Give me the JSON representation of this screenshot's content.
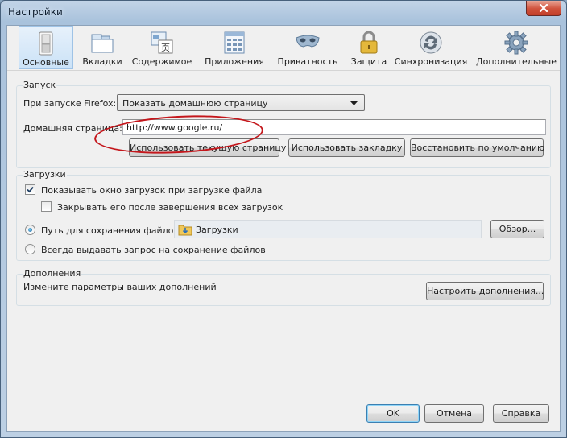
{
  "window": {
    "title": "Настройки"
  },
  "toolbar": {
    "items": [
      {
        "label": "Основные",
        "icon": "switch-icon",
        "active": true
      },
      {
        "label": "Вкладки",
        "icon": "tabs-icon"
      },
      {
        "label": "Содержимое",
        "icon": "content-icon"
      },
      {
        "label": "Приложения",
        "icon": "applications-icon"
      },
      {
        "label": "Приватность",
        "icon": "mask-icon"
      },
      {
        "label": "Защита",
        "icon": "lock-icon"
      },
      {
        "label": "Синхронизация",
        "icon": "sync-icon"
      },
      {
        "label": "Дополнительные",
        "icon": "gear-icon"
      }
    ]
  },
  "startup": {
    "group_title": "Запуск",
    "on_start_label": "При запуске Firefox:",
    "on_start_value": "Показать домашнюю страницу",
    "homepage_label": "Домашняя страница:",
    "homepage_value": "http://www.google.ru/",
    "use_current_btn": "Использовать текущую страницу",
    "use_bookmark_btn": "Использовать закладку",
    "restore_default_btn": "Восстановить по умолчанию"
  },
  "downloads": {
    "group_title": "Загрузки",
    "show_window_label": "Показывать окно загрузок при загрузке файла",
    "show_window_checked": true,
    "close_when_done_label": "Закрывать его после завершения всех загрузок",
    "close_when_done_checked": false,
    "save_path_label": "Путь для сохранения файлов",
    "save_path_value": "Загрузки",
    "browse_btn": "Обзор...",
    "always_ask_label": "Всегда выдавать запрос на сохранение файлов"
  },
  "addons": {
    "group_title": "Дополнения",
    "description": "Измените параметры ваших дополнений",
    "manage_btn": "Настроить дополнения..."
  },
  "footer": {
    "ok_btn": "OK",
    "cancel_btn": "Отмена",
    "help_btn": "Справка"
  },
  "colors": {
    "annotation_ellipse": "#c4171c",
    "active_tab": "#cbe2f7",
    "close_button": "#d0523c"
  }
}
